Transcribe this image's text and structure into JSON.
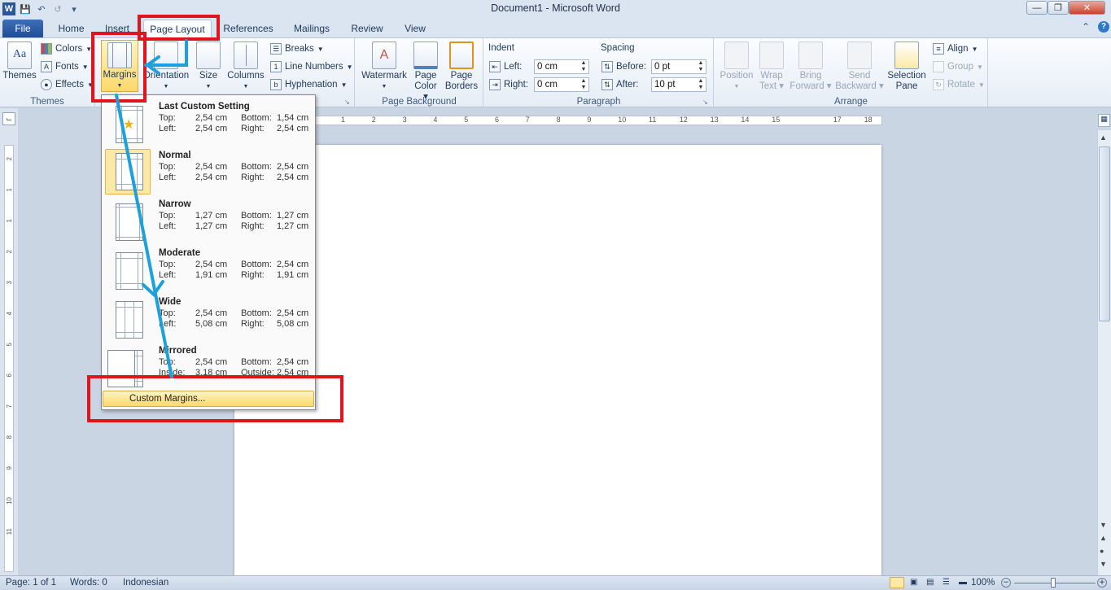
{
  "window": {
    "title": "Document1 - Microsoft Word",
    "app_icon": "W"
  },
  "colors": {
    "file_tab": "#2b579a",
    "highlight": "#fde9a6",
    "annotation_red": "#e0141d",
    "annotation_blue": "#1ea0dc"
  },
  "tabs": [
    "File",
    "Home",
    "Insert",
    "Page Layout",
    "References",
    "Mailings",
    "Review",
    "View"
  ],
  "ribbon": {
    "themes": {
      "themes_label": "Themes",
      "colors": "Colors",
      "fonts": "Fonts",
      "effects": "Effects",
      "group": "Themes"
    },
    "page_setup": {
      "margins": "Margins",
      "orientation": "Orientation",
      "size": "Size",
      "columns": "Columns",
      "breaks": "Breaks",
      "line_numbers": "Line Numbers",
      "hyphenation": "Hyphenation"
    },
    "background": {
      "watermark": "Watermark",
      "page_color_1": "Page",
      "page_color_2": "Color",
      "page_borders_1": "Page",
      "page_borders_2": "Borders",
      "group": "Page Background"
    },
    "paragraph": {
      "indent": "Indent",
      "left": "Left:",
      "left_val": "0 cm",
      "right": "Right:",
      "right_val": "0 cm",
      "spacing": "Spacing",
      "before": "Before:",
      "before_val": "0 pt",
      "after": "After:",
      "after_val": "10 pt",
      "group": "Paragraph"
    },
    "arrange": {
      "position": "Position",
      "wrap_1": "Wrap",
      "wrap_2": "Text",
      "bring_1": "Bring",
      "bring_2": "Forward",
      "send_1": "Send",
      "send_2": "Backward",
      "selection_1": "Selection",
      "selection_2": "Pane",
      "align": "Align",
      "group_btn": "Group",
      "rotate": "Rotate",
      "group": "Arrange"
    }
  },
  "margins_menu": [
    {
      "title": "Last Custom Setting",
      "icon": "star-icon",
      "top": "2,54 cm",
      "bottom": "1,54 cm",
      "left": "2,54 cm",
      "right": "2,54 cm",
      "l1": "Top:",
      "l2": "Left:",
      "l3": "Bottom:",
      "l4": "Right:"
    },
    {
      "title": "Normal",
      "top": "2,54 cm",
      "bottom": "2,54 cm",
      "left": "2,54 cm",
      "right": "2,54 cm",
      "l1": "Top:",
      "l2": "Left:",
      "l3": "Bottom:",
      "l4": "Right:"
    },
    {
      "title": "Narrow",
      "top": "1,27 cm",
      "bottom": "1,27 cm",
      "left": "1,27 cm",
      "right": "1,27 cm",
      "l1": "Top:",
      "l2": "Left:",
      "l3": "Bottom:",
      "l4": "Right:"
    },
    {
      "title": "Moderate",
      "top": "2,54 cm",
      "bottom": "2,54 cm",
      "left": "1,91 cm",
      "right": "1,91 cm",
      "l1": "Top:",
      "l2": "Left:",
      "l3": "Bottom:",
      "l4": "Right:"
    },
    {
      "title": "Wide",
      "top": "2,54 cm",
      "bottom": "2,54 cm",
      "left": "5,08 cm",
      "right": "5,08 cm",
      "l1": "Top:",
      "l2": "Left:",
      "l3": "Bottom:",
      "l4": "Right:"
    },
    {
      "title": "Mirrored",
      "top": "2,54 cm",
      "bottom": "2,54 cm",
      "left": "3,18 cm",
      "right": "2,54 cm",
      "l1": "Top:",
      "l2": "Inside:",
      "l3": "Bottom:",
      "l4": "Outside:"
    }
  ],
  "custom_margins": "Custom Margins...",
  "hruler_ticks": [
    "1",
    "2",
    "3",
    "4",
    "5",
    "6",
    "7",
    "8",
    "9",
    "10",
    "11",
    "12",
    "13",
    "14",
    "15",
    "17",
    "18"
  ],
  "vruler_ticks": [
    "2",
    "1",
    "1",
    "2",
    "3",
    "4",
    "5",
    "6",
    "7",
    "8",
    "9",
    "10",
    "11"
  ],
  "status": {
    "page": "Page: 1 of 1",
    "words": "Words: 0",
    "language": "Indonesian",
    "zoom": "100%"
  }
}
